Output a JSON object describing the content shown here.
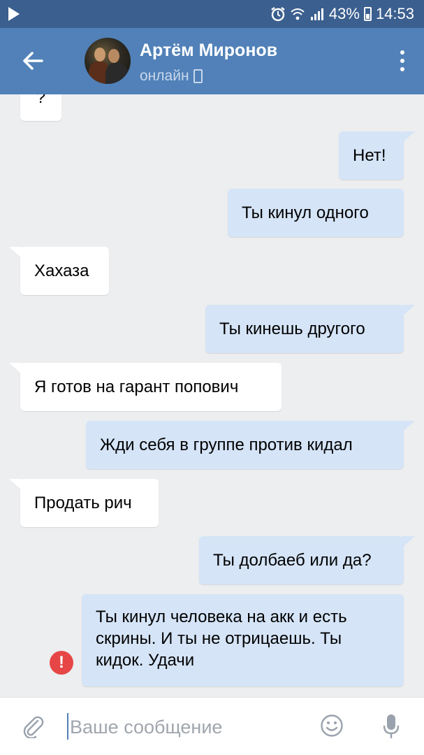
{
  "status_bar": {
    "battery": "43%",
    "time": "14:53",
    "icons": [
      "play-icon",
      "alarm-icon",
      "wifi-icon",
      "signal-icon",
      "battery-icon"
    ]
  },
  "header": {
    "contact_name": "Артём Миронов",
    "status": "онлайн",
    "icons": [
      "back-arrow-icon",
      "avatar",
      "mobile-icon",
      "more-vert-icon"
    ]
  },
  "messages": [
    {
      "direction": "in",
      "text": "?"
    },
    {
      "direction": "out",
      "text": "Нет!"
    },
    {
      "direction": "out",
      "text": "Ты кинул одного"
    },
    {
      "direction": "in",
      "text": "Хахаза"
    },
    {
      "direction": "out",
      "text": "Ты кинешь другого"
    },
    {
      "direction": "in",
      "text": "Я готов на гарант попович"
    },
    {
      "direction": "out",
      "text": "Жди себя в группе против кидал"
    },
    {
      "direction": "in",
      "text": "Продать рич"
    },
    {
      "direction": "out",
      "text": "Ты долбаеб или да?"
    },
    {
      "direction": "out",
      "text": "Ты кинул человека на акк и есть скрины. И ты не отрицаешь. Ты кидок. Удачи",
      "error_mark": "!"
    }
  ],
  "composer": {
    "placeholder": "Ваше сообщение",
    "icons": [
      "attach-icon",
      "emoji-icon",
      "mic-icon"
    ]
  },
  "colors": {
    "header_bg": "#5181b8",
    "statusbar_bg": "#3b5f8e",
    "chat_bg": "#edeef0",
    "incoming_bubble": "#ffffff",
    "outgoing_bubble": "#d5e4f7",
    "error": "#e64646"
  }
}
